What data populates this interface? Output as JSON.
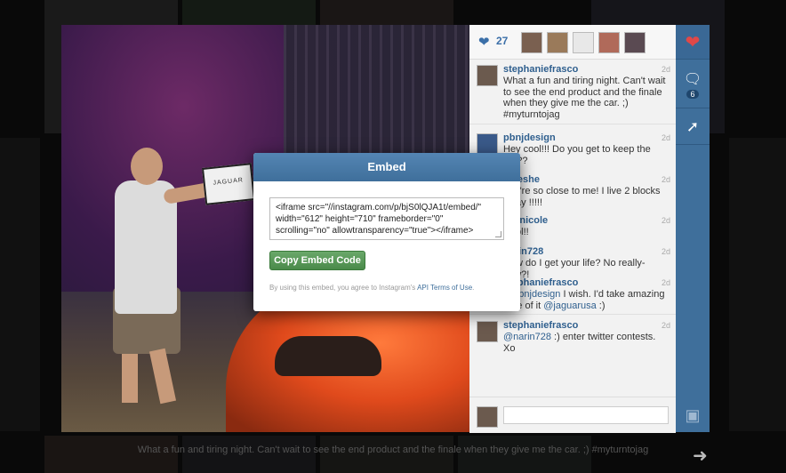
{
  "likes": {
    "count": "27"
  },
  "photo": {
    "clapper_text": "JAGUAR"
  },
  "comments": [
    {
      "user": "stephaniefrasco",
      "time": "2d",
      "text": "What a fun and tiring night. Can't wait to see the end product and the finale when they give me the car. ;) #myturntojag"
    },
    {
      "user": "pbnjdesign",
      "time": "2d",
      "text": "Hey cool!!! Do you get to keep the car??"
    },
    {
      "user": "aldeshe",
      "time": "2d",
      "text": "You're so close to me! I live 2 blocks away !!!!!"
    },
    {
      "user": "keynicole",
      "time": "2d",
      "text": "Cool!!"
    },
    {
      "user": "narin728",
      "time": "2d",
      "text": "How do I get your life? No really- how?!"
    },
    {
      "user": "stephaniefrasco",
      "time": "2d",
      "text_mention": "@pbnjdesign",
      "text_mid": " I wish. I'd take amazing care of it ",
      "text_mention2": "@jaguarusa",
      "text_end": " :)"
    },
    {
      "user": "stephaniefrasco",
      "time": "2d",
      "text_mention": "@narin728",
      "text_end": " :) enter twitter contests. Xo"
    }
  ],
  "rail": {
    "comment_count": "6"
  },
  "caption": "What a fun and tiring night. Can't wait to see the end product and the finale when they give me the car. ;) #myturntojag",
  "modal": {
    "title": "Embed",
    "embed_code": "<iframe src=\"//instagram.com/p/bjS0lQJA1t/embed/\" width=\"612\" height=\"710\" frameborder=\"0\" scrolling=\"no\" allowtransparency=\"true\"></iframe>",
    "copy_label": "Copy Embed Code",
    "terms_prefix": "By using this embed, you agree to Instagram's ",
    "terms_link": "API Terms of Use",
    "terms_suffix": "."
  },
  "colors": {
    "accent": "#3f6f9b",
    "heart": "#e04848",
    "copy_button": "#4a8a4a"
  },
  "icons": [
    "heart-icon",
    "comment-icon",
    "share-icon",
    "instagram-icon",
    "next-arrow-icon"
  ]
}
